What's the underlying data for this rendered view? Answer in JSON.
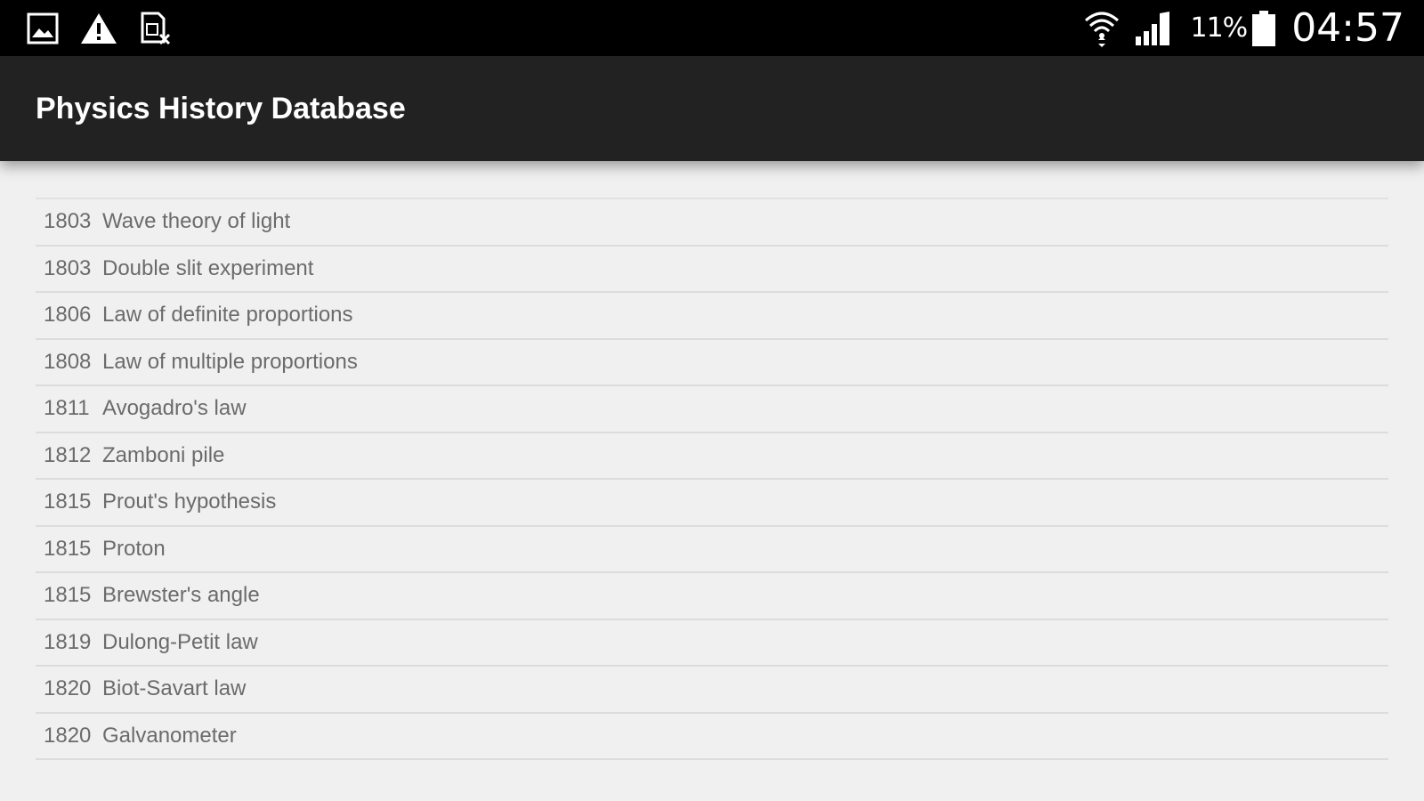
{
  "status_bar": {
    "left_icons": [
      "image-notification-icon",
      "warning-icon",
      "sim-error-icon"
    ],
    "battery_percent": "11%",
    "time": "04:57"
  },
  "app_bar": {
    "title": "Physics History Database"
  },
  "entries": [
    {
      "year": "1803",
      "name": "Wave theory of light"
    },
    {
      "year": "1803",
      "name": "Double slit experiment"
    },
    {
      "year": "1806",
      "name": "Law of definite proportions"
    },
    {
      "year": "1808",
      "name": "Law of multiple proportions"
    },
    {
      "year": "1811",
      "name": "Avogadro's law"
    },
    {
      "year": "1812",
      "name": "Zamboni pile"
    },
    {
      "year": "1815",
      "name": "Prout's hypothesis"
    },
    {
      "year": "1815",
      "name": "Proton"
    },
    {
      "year": "1815",
      "name": "Brewster's angle"
    },
    {
      "year": "1819",
      "name": "Dulong-Petit law"
    },
    {
      "year": "1820",
      "name": "Biot-Savart law"
    },
    {
      "year": "1820",
      "name": "Galvanometer"
    }
  ],
  "colors": {
    "status_bar": "#000000",
    "app_bar": "#222222",
    "background": "#f0f0f0",
    "item_text": "#6b6b6b",
    "divider": "#dcdcdc"
  }
}
